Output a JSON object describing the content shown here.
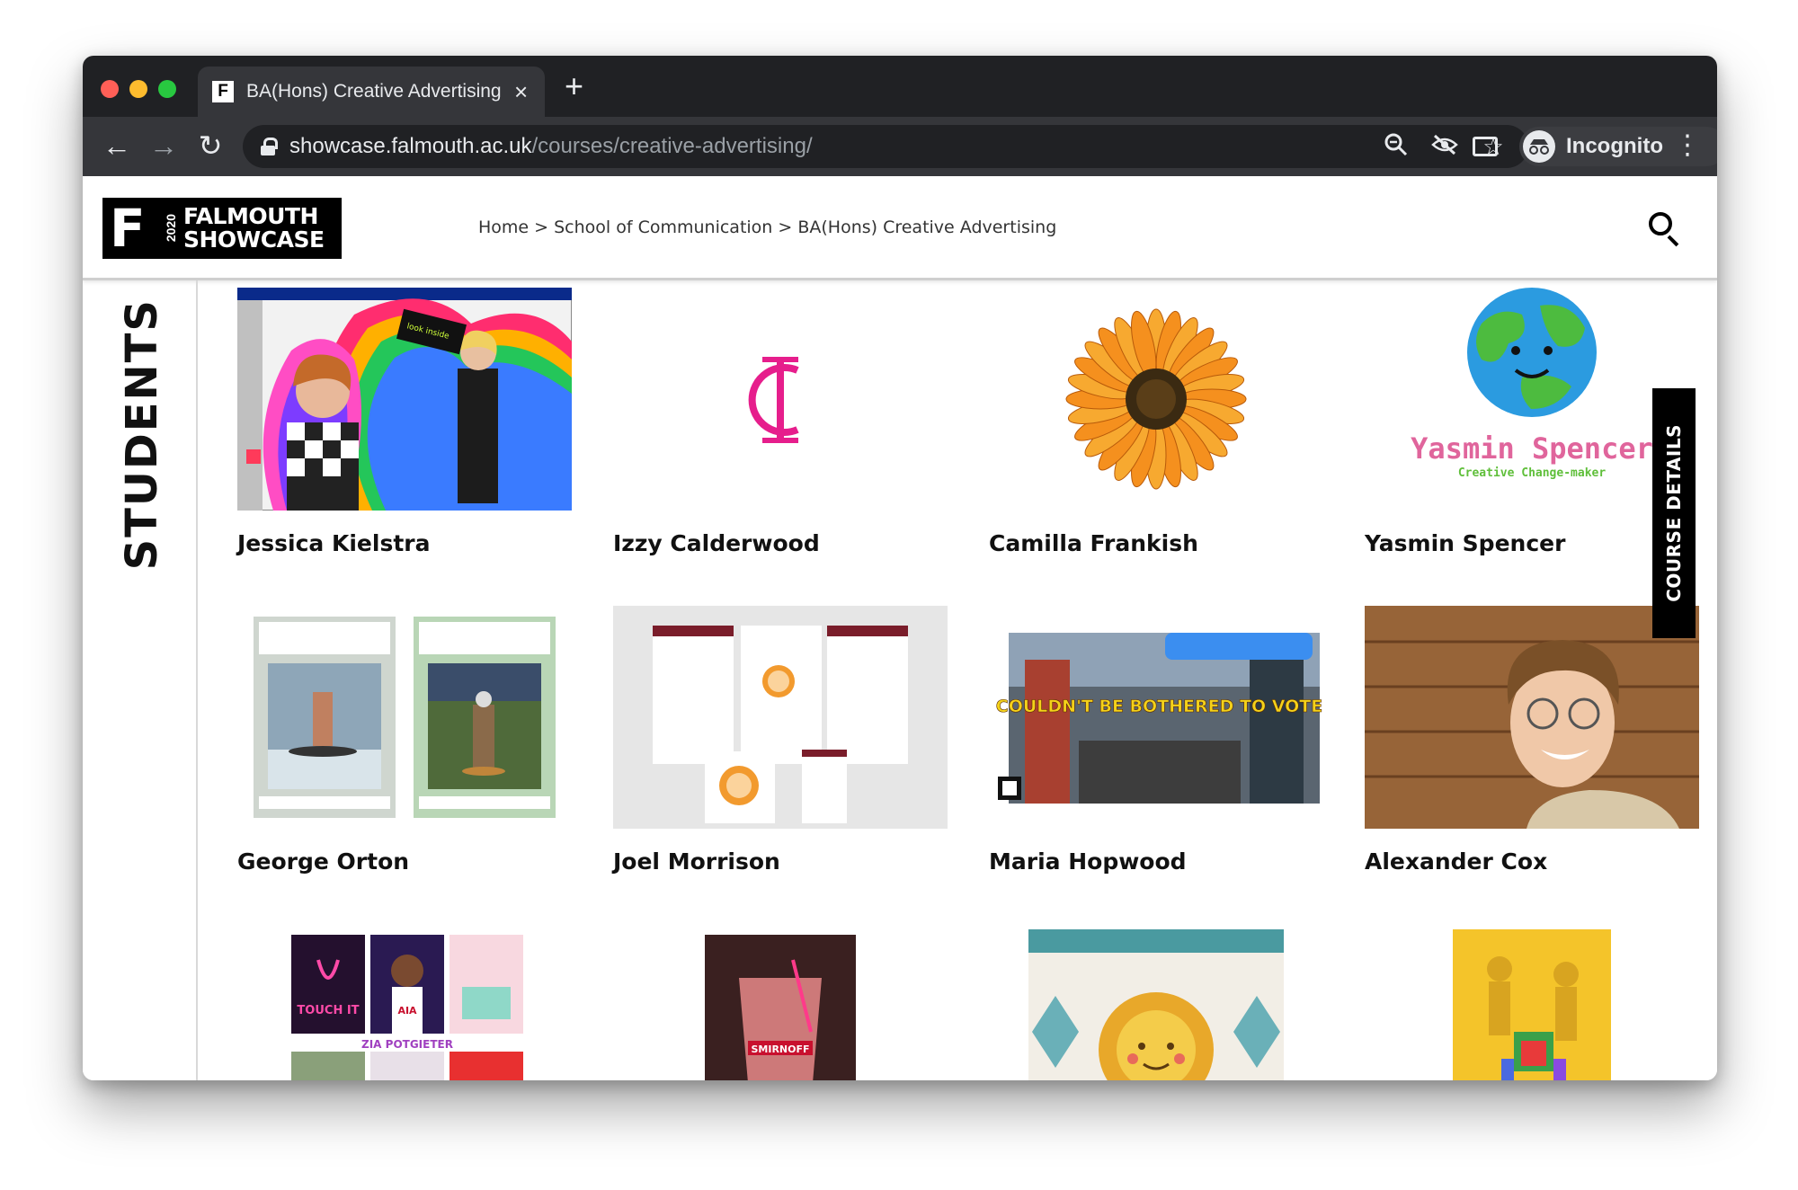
{
  "browser": {
    "tab_title": "BA(Hons) Creative Advertising",
    "tab_favicon": "F",
    "url_domain": "showcase.falmouth.ac.uk",
    "url_path": "/courses/creative-advertising/",
    "profile_label": "Incognito",
    "icons": [
      "back-arrow-icon",
      "forward-arrow-icon",
      "reload-icon",
      "lock-icon",
      "zoom-icon",
      "eye-off-icon",
      "star-icon",
      "cast-icon",
      "incognito-icon",
      "kebab-menu-icon"
    ]
  },
  "header": {
    "logo_f": "F",
    "logo_year": "2020",
    "logo_line1": "FALMOUTH",
    "logo_line2": "SHOWCASE",
    "breadcrumb": "Home > School of Communication > BA(Hons) Creative Advertising"
  },
  "rail": {
    "label": "STUDENTS"
  },
  "course_details_label": "COURSE DETAILS",
  "students": [
    {
      "name": "Jessica Kielstra"
    },
    {
      "name": "Izzy Calderwood"
    },
    {
      "name": "Camilla Frankish"
    },
    {
      "name": "Yasmin Spencer"
    },
    {
      "name": "George Orton"
    },
    {
      "name": "Joel Morrison"
    },
    {
      "name": "Maria Hopwood"
    },
    {
      "name": "Alexander Cox"
    }
  ],
  "thumb_text": {
    "yasmin_name": "Yasmin Spencer",
    "yasmin_tagline": "Creative Change-maker",
    "maria_headline": "COULDN'T BE BOTHERED TO VOTE?",
    "zia_label": "ZIA POTGIETER",
    "smirnoff_label": "SMIRNOFF",
    "touch_label": "TOUCH IT",
    "aia_label": "AIA"
  },
  "colors": {
    "izzy_pink": "#e61e8c",
    "yasmin_pink": "#e0659c",
    "yasmin_green": "#5fbf3a",
    "sunflower_orange": "#f5901e",
    "yellow_tile": "#f4c42a"
  }
}
